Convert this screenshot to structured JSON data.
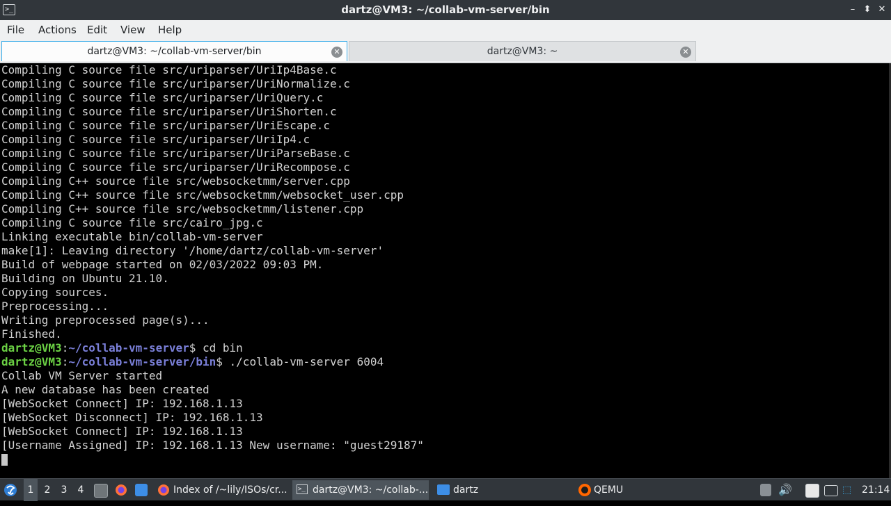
{
  "window": {
    "title": "dartz@VM3: ~/collab-vm-server/bin",
    "app_icon": ">_",
    "controls": {
      "minimize": "–",
      "maximize": "⬍",
      "close": "✕"
    }
  },
  "menu": [
    "File",
    "Actions",
    "Edit",
    "View",
    "Help"
  ],
  "tabs": [
    {
      "label": "dartz@VM3: ~/collab-vm-server/bin",
      "active": true
    },
    {
      "label": "dartz@VM3: ~",
      "active": false
    }
  ],
  "terminal": {
    "lines": [
      "Compiling C source file src/uriparser/UriIp4Base.c",
      "Compiling C source file src/uriparser/UriNormalize.c",
      "Compiling C source file src/uriparser/UriQuery.c",
      "Compiling C source file src/uriparser/UriShorten.c",
      "Compiling C source file src/uriparser/UriEscape.c",
      "Compiling C source file src/uriparser/UriIp4.c",
      "Compiling C source file src/uriparser/UriParseBase.c",
      "Compiling C source file src/uriparser/UriRecompose.c",
      "Compiling C++ source file src/websocketmm/server.cpp",
      "Compiling C++ source file src/websocketmm/websocket_user.cpp",
      "Compiling C++ source file src/websocketmm/listener.cpp",
      "Compiling C source file src/cairo_jpg.c",
      "Linking executable bin/collab-vm-server",
      "make[1]: Leaving directory '/home/dartz/collab-vm-server'",
      "Build of webpage started on 02/03/2022 09:03 PM.",
      "Building on Ubuntu 21.10.",
      "Copying sources.",
      "Preprocessing...",
      "Writing preprocessed page(s)...",
      "Finished."
    ],
    "prompts": [
      {
        "user": "dartz@VM3",
        "sep": ":",
        "path": "~/collab-vm-server",
        "symbol": "$",
        "command": " cd bin"
      },
      {
        "user": "dartz@VM3",
        "sep": ":",
        "path": "~/collab-vm-server/bin",
        "symbol": "$",
        "command": " ./collab-vm-server 6004"
      }
    ],
    "output": [
      "Collab VM Server started",
      "A new database has been created",
      "[WebSocket Connect] IP: 192.168.1.13",
      "[WebSocket Disconnect] IP: 192.168.1.13",
      "[WebSocket Connect] IP: 192.168.1.13",
      "[Username Assigned] IP: 192.168.1.13 New username: \"guest29187\""
    ]
  },
  "taskbar": {
    "workspaces": [
      "1",
      "2",
      "3",
      "4"
    ],
    "active_workspace": "1",
    "tasks": [
      {
        "label": "Index of /~lily/ISOs/cr...",
        "icon": "firefox-icon"
      },
      {
        "label": "dartz@VM3: ~/collab-...",
        "icon": "terminal-icon",
        "active": true
      },
      {
        "label": "dartz",
        "icon": "folder-icon"
      },
      {
        "label": "QEMU",
        "icon": "qemu-icon"
      }
    ],
    "clock": "21:14"
  },
  "colors": {
    "prompt_user": "#6bd144",
    "prompt_path": "#7a7fd8",
    "terminal_bg": "#000000",
    "terminal_fg": "#d2d2d2",
    "accent": "#3daee9"
  }
}
